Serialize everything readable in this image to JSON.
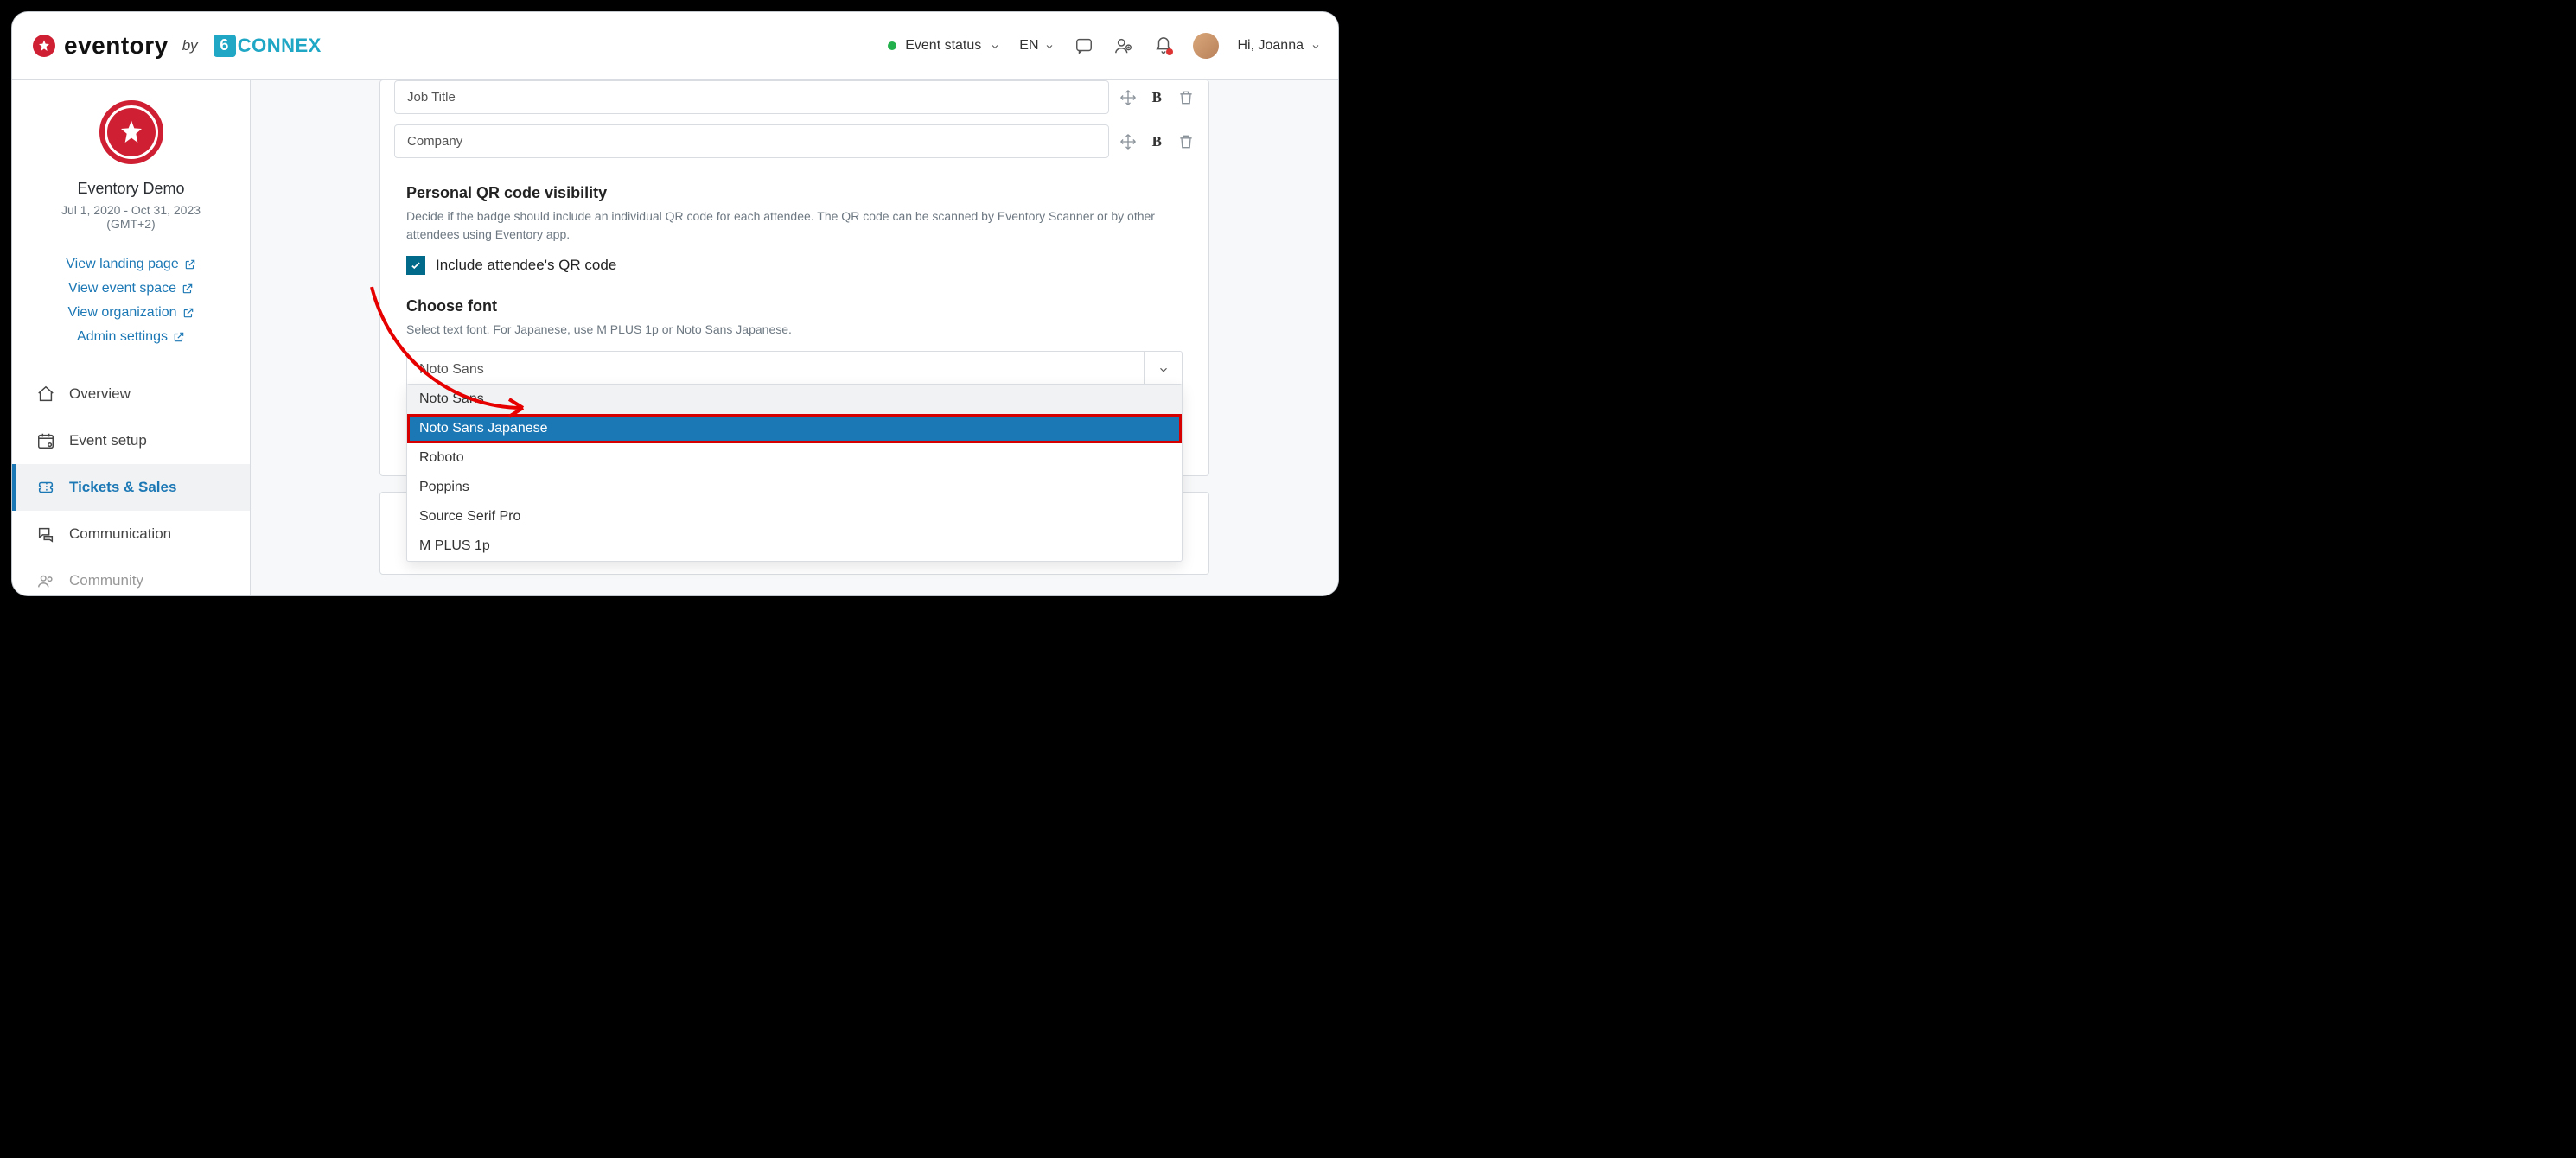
{
  "header": {
    "brand_word": "eventory",
    "brand_by": "by",
    "brand_partner_six": "6",
    "brand_partner_rest": "CONNEX",
    "event_status_label": "Event status",
    "language": "EN",
    "greeting": "Hi, Joanna"
  },
  "sidebar": {
    "event_name": "Eventory Demo",
    "event_dates": "Jul 1, 2020 - Oct 31, 2023",
    "event_tz": "(GMT+2)",
    "links": {
      "landing": "View landing page",
      "space": "View event space",
      "org": "View organization",
      "admin": "Admin settings"
    },
    "nav": {
      "overview": "Overview",
      "event_setup": "Event setup",
      "tickets": "Tickets & Sales",
      "communication": "Communication",
      "community": "Community"
    }
  },
  "content": {
    "fields": {
      "job_title": "Job Title",
      "company": "Company"
    },
    "qr": {
      "heading": "Personal QR code visibility",
      "desc": "Decide if the badge should include an individual QR code for each attendee. The QR code can be scanned by Eventory Scanner or by other attendees using Eventory app.",
      "checkbox_label": "Include attendee's QR code"
    },
    "font": {
      "heading": "Choose font",
      "desc": "Select text font. For Japanese, use M PLUS 1p or Noto Sans Japanese.",
      "selected": "Noto Sans",
      "options": {
        "o0": "Noto Sans",
        "o1": "Noto Sans Japanese",
        "o2": "Roboto",
        "o3": "Poppins",
        "o4": "Source Serif Pro",
        "o5": "M PLUS 1p"
      }
    }
  }
}
